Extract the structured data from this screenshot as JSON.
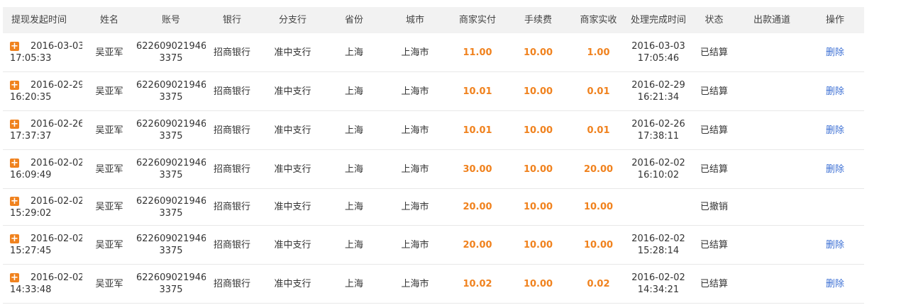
{
  "colors": {
    "accent": "#f0821e",
    "link": "#3b6fd4",
    "header_bg": "#f2f2f2"
  },
  "headers": [
    "提现发起时间",
    "姓名",
    "账号",
    "银行",
    "分支行",
    "省份",
    "城市",
    "商家实付",
    "手续费",
    "商家实收",
    "处理完成时间",
    "状态",
    "出款通道",
    "操作"
  ],
  "rows": [
    {
      "start_date": "2016-03-03",
      "start_time": "17:05:33",
      "name": "吴亚军",
      "acct1": "622609021946",
      "acct2": "3375",
      "bank": "招商银行",
      "branch": "准中支行",
      "province": "上海",
      "city": "上海市",
      "paid": "11.00",
      "fee": "10.00",
      "received": "1.00",
      "end_date": "2016-03-03",
      "end_time": "17:05:46",
      "status": "已结算",
      "channel": "",
      "action": "删除"
    },
    {
      "start_date": "2016-02-29",
      "start_time": "16:20:35",
      "name": "吴亚军",
      "acct1": "622609021946",
      "acct2": "3375",
      "bank": "招商银行",
      "branch": "准中支行",
      "province": "上海",
      "city": "上海市",
      "paid": "10.01",
      "fee": "10.00",
      "received": "0.01",
      "end_date": "2016-02-29",
      "end_time": "16:21:34",
      "status": "已结算",
      "channel": "",
      "action": "删除"
    },
    {
      "start_date": "2016-02-26",
      "start_time": "17:37:37",
      "name": "吴亚军",
      "acct1": "622609021946",
      "acct2": "3375",
      "bank": "招商银行",
      "branch": "准中支行",
      "province": "上海",
      "city": "上海市",
      "paid": "10.01",
      "fee": "10.00",
      "received": "0.01",
      "end_date": "2016-02-26",
      "end_time": "17:38:11",
      "status": "已结算",
      "channel": "",
      "action": "删除"
    },
    {
      "start_date": "2016-02-02",
      "start_time": "16:09:49",
      "name": "吴亚军",
      "acct1": "622609021946",
      "acct2": "3375",
      "bank": "招商银行",
      "branch": "准中支行",
      "province": "上海",
      "city": "上海市",
      "paid": "30.00",
      "fee": "10.00",
      "received": "20.00",
      "end_date": "2016-02-02",
      "end_time": "16:10:02",
      "status": "已结算",
      "channel": "",
      "action": "删除"
    },
    {
      "start_date": "2016-02-02",
      "start_time": "15:29:02",
      "name": "吴亚军",
      "acct1": "622609021946",
      "acct2": "3375",
      "bank": "招商银行",
      "branch": "准中支行",
      "province": "上海",
      "city": "上海市",
      "paid": "20.00",
      "fee": "10.00",
      "received": "10.00",
      "end_date": "",
      "end_time": "",
      "status": "已撤销",
      "channel": "",
      "action": ""
    },
    {
      "start_date": "2016-02-02",
      "start_time": "15:27:45",
      "name": "吴亚军",
      "acct1": "622609021946",
      "acct2": "3375",
      "bank": "招商银行",
      "branch": "准中支行",
      "province": "上海",
      "city": "上海市",
      "paid": "20.00",
      "fee": "10.00",
      "received": "10.00",
      "end_date": "2016-02-02",
      "end_time": "15:28:14",
      "status": "已结算",
      "channel": "",
      "action": "删除"
    },
    {
      "start_date": "2016-02-02",
      "start_time": "14:33:48",
      "name": "吴亚军",
      "acct1": "622609021946",
      "acct2": "3375",
      "bank": "招商银行",
      "branch": "准中支行",
      "province": "上海",
      "city": "上海市",
      "paid": "10.02",
      "fee": "10.00",
      "received": "0.02",
      "end_date": "2016-02-02",
      "end_time": "14:34:21",
      "status": "已结算",
      "channel": "",
      "action": "删除"
    }
  ]
}
